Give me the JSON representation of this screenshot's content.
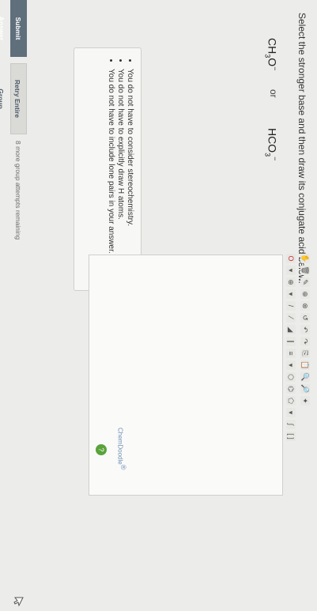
{
  "prompt": "Select the stronger base and then draw its conjugate acid below.",
  "options": {
    "first": {
      "base": "CH",
      "sub": "3",
      "rest": "O",
      "sup": "−"
    },
    "or_label": "or",
    "second": {
      "base": "HCO",
      "sub": "3",
      "sup": "−"
    }
  },
  "notes": [
    "You do not have to consider stereochemistry.",
    "You do not have to explicitly draw H atoms.",
    "You do not have to include lone pairs in your answer."
  ],
  "editor": {
    "brand": "ChemDoodle",
    "brand_mark": "®",
    "help": "?"
  },
  "buttons": {
    "submit": "Submit Answer",
    "retry": "Retry Entire Group"
  },
  "status": "8 more group attempts remaining"
}
